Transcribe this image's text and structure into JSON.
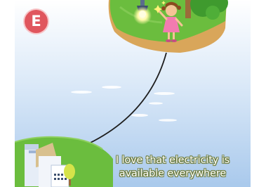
{
  "panel": {
    "badge_letter": "E",
    "caption_line1": "I love that electricity is",
    "caption_line2": "available everywhere"
  },
  "scene": {
    "sky_top": "#ffffff",
    "sky_bottom": "#a9c9ec",
    "grass": "#6bbd3e",
    "island_soil": "#d9a65a",
    "wire": "#1e1e1e",
    "badge_color": "#e0565e"
  }
}
